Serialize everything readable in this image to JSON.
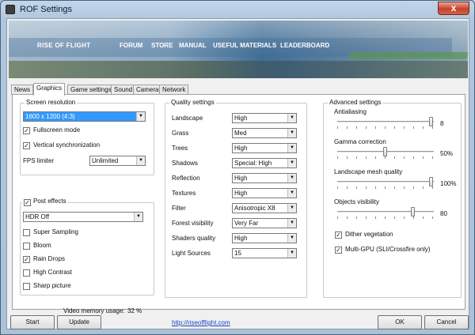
{
  "window": {
    "title": "ROF Settings",
    "close_glyph": "x"
  },
  "banner": {
    "logo": "RISE OF FLIGHT",
    "nav": [
      "FORUM",
      "STORE",
      "MANUAL",
      "USEFUL MATERIALS",
      "LEADERBOARD"
    ]
  },
  "tabs": [
    "News",
    "Graphics",
    "Game settings",
    "Sound",
    "Camera",
    "Network"
  ],
  "screen": {
    "title": "Screen resolution",
    "resolution": "1600 x 1200 (4:3)",
    "fullscreen_label": "Fullscreen mode",
    "fullscreen_checked": true,
    "vsync_label": "Vertical synchronization",
    "vsync_checked": true,
    "fps_label": "FPS limiter",
    "fps_value": "Unlimited"
  },
  "post": {
    "title": "Post effects",
    "checked": true,
    "hdr_value": "HDR Off",
    "options": [
      {
        "label": "Super Sampling",
        "checked": false
      },
      {
        "label": "Bloom",
        "checked": false
      },
      {
        "label": "Rain Drops",
        "checked": true
      },
      {
        "label": "High Contrast",
        "checked": false
      },
      {
        "label": "Sharp picture",
        "checked": false
      }
    ]
  },
  "memory": {
    "label": "Video memory usage:",
    "value": "32 %"
  },
  "quality": {
    "title": "Quality settings",
    "rows": [
      {
        "label": "Landscape",
        "value": "High"
      },
      {
        "label": "Grass",
        "value": "Med"
      },
      {
        "label": "Trees",
        "value": "High"
      },
      {
        "label": "Shadows",
        "value": "Special: High"
      },
      {
        "label": "Reflection",
        "value": "High"
      },
      {
        "label": "Textures",
        "value": "High"
      },
      {
        "label": "Filter",
        "value": "Anisotropic X8"
      },
      {
        "label": "Forest visibility",
        "value": "Very Far"
      },
      {
        "label": "Shaders quality",
        "value": "High"
      },
      {
        "label": "Light Sources",
        "value": "15"
      }
    ]
  },
  "advanced": {
    "title": "Advanced settings",
    "sliders": [
      {
        "label": "Antialiasing",
        "value_text": "8",
        "fraction": 1.0
      },
      {
        "label": "Gamma correction",
        "value_text": "50%",
        "fraction": 0.5
      },
      {
        "label": "Landscape mesh quality",
        "value_text": "100%",
        "fraction": 1.0
      },
      {
        "label": "Objects visibility",
        "value_text": "80",
        "fraction": 0.8
      }
    ],
    "dither_label": "Dither vegetation",
    "dither_checked": true,
    "multigpu_label": "Multi-GPU (SLI/Crossfire only)",
    "multigpu_checked": true
  },
  "footer": {
    "start": "Start",
    "update": "Update",
    "link": "http://riseofflight.com",
    "ok": "OK",
    "cancel": "Cancel"
  }
}
